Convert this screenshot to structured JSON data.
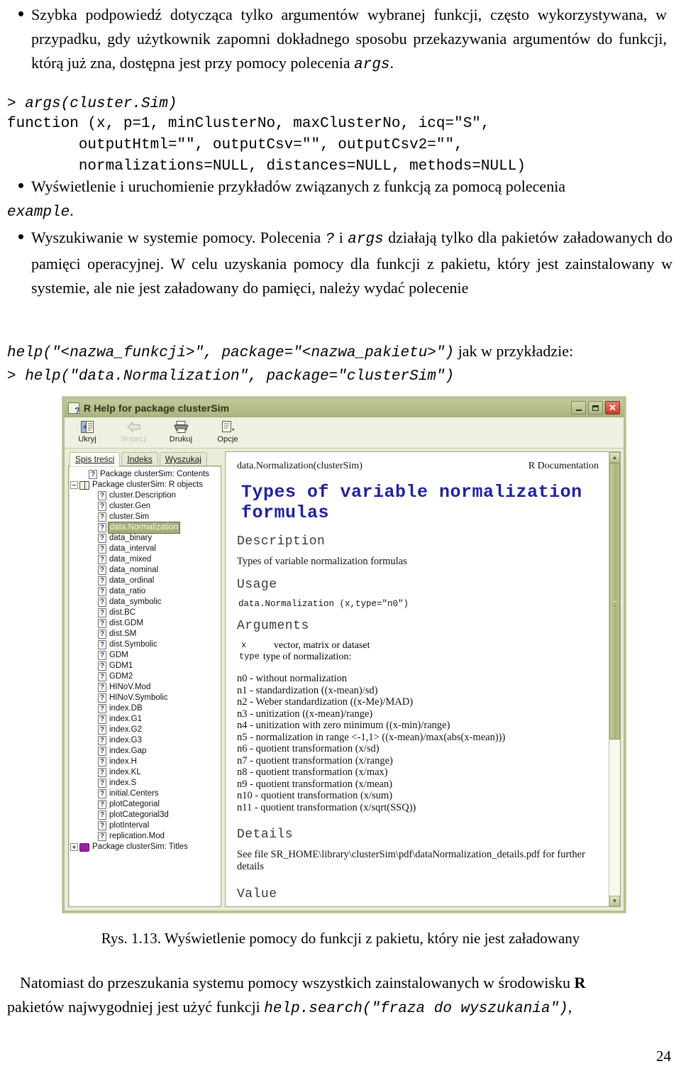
{
  "document": {
    "bullets": [
      {
        "id": "args-bullet",
        "segments": [
          {
            "t": "Szybka podpowiedź dotycząca tylko argumentów wybranej funkcji, często wykorzystywana, w przypadku, gdy użytkownik zapomni dokładnego sposobu przekazywania argumentów do funkcji, którą już zna, dostępna jest przy pomocy polecenia ",
            "style": "normal"
          },
          {
            "t": "args",
            "style": "mono"
          },
          {
            "t": ".",
            "style": "normal"
          }
        ]
      }
    ],
    "code_block_1": "> args(cluster.Sim)\nfunction (x, p=1, minClusterNo, maxClusterNo, icq=\"S\",\n        outputHtml=\"\", outputCsv=\"\", outputCsv2=\"\",\n        normalizations=NULL, distances=NULL, methods=NULL)",
    "code_block_1_prompt": "> args(cluster.Sim)",
    "code_block_1_rest": "function (x, p=1, minClusterNo, maxClusterNo, icq=\"S\",\n        outputHtml=\"\", outputCsv=\"\", outputCsv2=\"\",\n        normalizations=NULL, distances=NULL, methods=NULL)",
    "bullet_example_pre": "Wyświetlenie i uruchomienie przykładów związanych z funkcją za pomocą polecenia ",
    "bullet_example_mono": "example",
    "bullet_example_post": ".",
    "bullet_search_p1": "Wyszukiwanie w systemie pomocy. Polecenia ",
    "bullet_search_m1": "?",
    "bullet_search_p2": " i ",
    "bullet_search_m2": "args",
    "bullet_search_p3": " działają tylko dla pakietów załadowanych do pamięci operacyjnej. W celu uzyskania pomocy dla funkcji z pakietu, który jest zainstalowany w systemie, ale nie jest załadowany do pamięci, należy wydać polecenie ",
    "bullet_search_m3": "help(\"<nazwa_funkcji>\", package=\"<nazwa_pakietu>\")",
    "bullet_search_p4": " jak w przykładzie:",
    "code_block_2": "> help(\"data.Normalization\", package=\"clusterSim\")",
    "caption": "Rys. 1.13. Wyświetlenie pomocy do funkcji z pakietu, który nie jest załadowany",
    "footer_p1": "Natomiast do przeszukania systemu pomocy wszystkich zainstalowanych w środowisku ",
    "footer_R": "R",
    "footer_p2": " pakietów najwygodniej jest użyć funkcji ",
    "footer_mono": "help.search(\"fraza do wyszukania\")",
    "footer_p3": ",",
    "page_number": "24"
  },
  "screenshot": {
    "window": {
      "title": "R Help for package clusterSim",
      "icon": "help-document-icon",
      "buttons": {
        "minimize": "_",
        "maximize": "□",
        "close": "✕"
      }
    },
    "toolbar": [
      {
        "label": "Ukryj",
        "icon": "hide-pane-icon",
        "disabled": false
      },
      {
        "label": "Wstecz",
        "icon": "back-arrow-icon",
        "disabled": true
      },
      {
        "label": "Drukuj",
        "icon": "printer-icon",
        "disabled": false
      },
      {
        "label": "Opcje",
        "icon": "options-icon",
        "disabled": false
      }
    ],
    "tabs": [
      {
        "label": "Spis treści",
        "active": true
      },
      {
        "label": "Indeks",
        "active": false
      },
      {
        "label": "Wyszukaj",
        "active": false
      }
    ],
    "tree": [
      {
        "label": "Package clusterSim:  Contents",
        "icon": "question-page-icon",
        "indent": 1,
        "expander": "none",
        "selected": false
      },
      {
        "label": "Package clusterSim:  R objects",
        "icon": "open-book-icon",
        "indent": 0,
        "expander": "minus",
        "selected": false
      },
      {
        "label": "cluster.Description",
        "icon": "question-page-icon",
        "indent": 2,
        "expander": "none",
        "selected": false
      },
      {
        "label": "cluster.Gen",
        "icon": "question-page-icon",
        "indent": 2,
        "expander": "none",
        "selected": false
      },
      {
        "label": "cluster.Sim",
        "icon": "question-page-icon",
        "indent": 2,
        "expander": "none",
        "selected": false
      },
      {
        "label": "data.Normalization",
        "icon": "question-page-icon",
        "indent": 2,
        "expander": "none",
        "selected": true
      },
      {
        "label": "data_binary",
        "icon": "question-page-icon",
        "indent": 2,
        "expander": "none",
        "selected": false
      },
      {
        "label": "data_interval",
        "icon": "question-page-icon",
        "indent": 2,
        "expander": "none",
        "selected": false
      },
      {
        "label": "data_mixed",
        "icon": "question-page-icon",
        "indent": 2,
        "expander": "none",
        "selected": false
      },
      {
        "label": "data_nominal",
        "icon": "question-page-icon",
        "indent": 2,
        "expander": "none",
        "selected": false
      },
      {
        "label": "data_ordinal",
        "icon": "question-page-icon",
        "indent": 2,
        "expander": "none",
        "selected": false
      },
      {
        "label": "data_ratio",
        "icon": "question-page-icon",
        "indent": 2,
        "expander": "none",
        "selected": false
      },
      {
        "label": "data_symbolic",
        "icon": "question-page-icon",
        "indent": 2,
        "expander": "none",
        "selected": false
      },
      {
        "label": "dist.BC",
        "icon": "question-page-icon",
        "indent": 2,
        "expander": "none",
        "selected": false
      },
      {
        "label": "dist.GDM",
        "icon": "question-page-icon",
        "indent": 2,
        "expander": "none",
        "selected": false
      },
      {
        "label": "dist.SM",
        "icon": "question-page-icon",
        "indent": 2,
        "expander": "none",
        "selected": false
      },
      {
        "label": "dist.Symbolic",
        "icon": "question-page-icon",
        "indent": 2,
        "expander": "none",
        "selected": false
      },
      {
        "label": "GDM",
        "icon": "question-page-icon",
        "indent": 2,
        "expander": "none",
        "selected": false
      },
      {
        "label": "GDM1",
        "icon": "question-page-icon",
        "indent": 2,
        "expander": "none",
        "selected": false
      },
      {
        "label": "GDM2",
        "icon": "question-page-icon",
        "indent": 2,
        "expander": "none",
        "selected": false
      },
      {
        "label": "HINoV.Mod",
        "icon": "question-page-icon",
        "indent": 2,
        "expander": "none",
        "selected": false
      },
      {
        "label": "HINoV.Symbolic",
        "icon": "question-page-icon",
        "indent": 2,
        "expander": "none",
        "selected": false
      },
      {
        "label": "index.DB",
        "icon": "question-page-icon",
        "indent": 2,
        "expander": "none",
        "selected": false
      },
      {
        "label": "index.G1",
        "icon": "question-page-icon",
        "indent": 2,
        "expander": "none",
        "selected": false
      },
      {
        "label": "index.G2",
        "icon": "question-page-icon",
        "indent": 2,
        "expander": "none",
        "selected": false
      },
      {
        "label": "index.G3",
        "icon": "question-page-icon",
        "indent": 2,
        "expander": "none",
        "selected": false
      },
      {
        "label": "index.Gap",
        "icon": "question-page-icon",
        "indent": 2,
        "expander": "none",
        "selected": false
      },
      {
        "label": "index.H",
        "icon": "question-page-icon",
        "indent": 2,
        "expander": "none",
        "selected": false
      },
      {
        "label": "index.KL",
        "icon": "question-page-icon",
        "indent": 2,
        "expander": "none",
        "selected": false
      },
      {
        "label": "index.S",
        "icon": "question-page-icon",
        "indent": 2,
        "expander": "none",
        "selected": false
      },
      {
        "label": "initial.Centers",
        "icon": "question-page-icon",
        "indent": 2,
        "expander": "none",
        "selected": false
      },
      {
        "label": "plotCategorial",
        "icon": "question-page-icon",
        "indent": 2,
        "expander": "none",
        "selected": false
      },
      {
        "label": "plotCategorial3d",
        "icon": "question-page-icon",
        "indent": 2,
        "expander": "none",
        "selected": false
      },
      {
        "label": "plotInterval",
        "icon": "question-page-icon",
        "indent": 2,
        "expander": "none",
        "selected": false
      },
      {
        "label": "replication.Mod",
        "icon": "question-page-icon",
        "indent": 2,
        "expander": "none",
        "selected": false
      },
      {
        "label": "Package clusterSim:  Titles",
        "icon": "purple-book-icon",
        "indent": 0,
        "expander": "plus",
        "selected": false
      }
    ],
    "help_content": {
      "header_left": "data.Normalization(clusterSim)",
      "header_right": "R Documentation",
      "title": "Types of variable normalization formulas",
      "sections": {
        "description_head": "Description",
        "description_body": "Types of variable normalization formulas",
        "usage_head": "Usage",
        "usage_code": "data.Normalization (x,type=\"n0\")",
        "arguments_head": "Arguments",
        "arg_x_name": "x",
        "arg_x_desc": "vector, matrix or dataset",
        "arg_type_name": "type",
        "arg_type_desc": "type of normalization:",
        "details_head": "Details",
        "details_body": "See file SR_HOME\\library\\clusterSim\\pdf\\dataNormalization_details.pdf for further details",
        "value_head": "Value"
      },
      "normalization_types": [
        "n0 - without normalization",
        "n1 - standardization ((x-mean)/sd)",
        "n2 - Weber standardization ((x-Me)/MAD)",
        "n3 - unitization ((x-mean)/range)",
        "n4 - unitization with zero minimum ((x-min)/range)",
        "n5 - normalization in range <-1,1> ((x-mean)/max(abs(x-mean)))",
        "n6 - quotient transformation (x/sd)",
        "n7 - quotient transformation (x/range)",
        "n8 - quotient transformation (x/max)",
        "n9 - quotient transformation (x/mean)",
        "n10 - quotient transformation (x/sum)",
        "n11 - quotient transformation (x/sqrt(SSQ))"
      ]
    },
    "colors": {
      "titlebar": "#b6c08d",
      "window_frame": "#b5bf8e",
      "accent_blue": "#21219c",
      "selection": "#a8ae7a",
      "close_button": "#c4402c"
    }
  }
}
